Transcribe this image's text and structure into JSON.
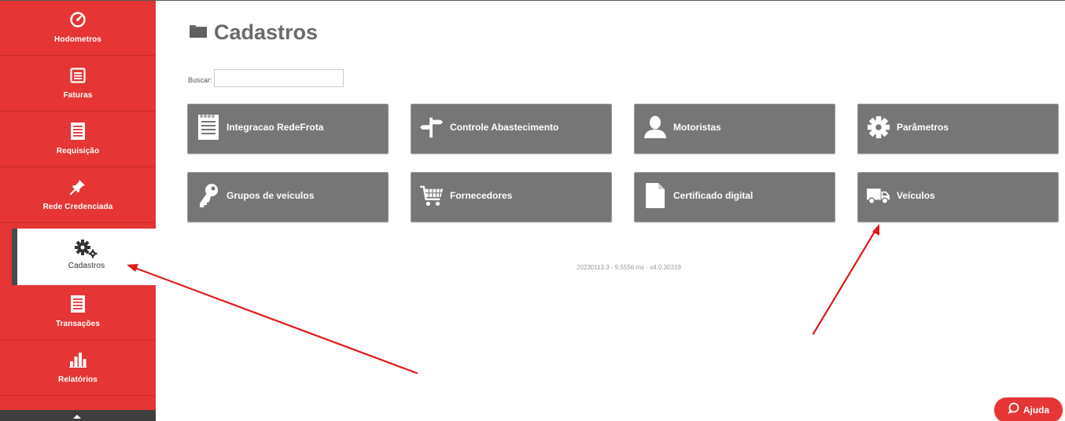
{
  "sidebar": {
    "items": [
      {
        "label": "Hodometros",
        "icon": "speedometer-icon"
      },
      {
        "label": "Faturas",
        "icon": "invoice-icon"
      },
      {
        "label": "Requisição",
        "icon": "document-list-icon"
      },
      {
        "label": "Rede Credenciada",
        "icon": "pushpin-icon"
      },
      {
        "label": "Cadastros",
        "icon": "gears-icon",
        "active": true
      },
      {
        "label": "Transações",
        "icon": "document-list-icon"
      },
      {
        "label": "Relatórios",
        "icon": "bar-chart-icon"
      }
    ]
  },
  "page": {
    "title": "Cadastros",
    "title_icon": "folder-icon"
  },
  "search": {
    "label": "Buscar:",
    "value": "",
    "placeholder": ""
  },
  "tiles": [
    {
      "label": "Integracao RedeFrota",
      "icon": "document-lines-icon"
    },
    {
      "label": "Controle Abastecimento",
      "icon": "signpost-icon"
    },
    {
      "label": "Motoristas",
      "icon": "user-icon"
    },
    {
      "label": "Parâmetros",
      "icon": "gear-icon"
    },
    {
      "label": "Grupos de veiculos",
      "icon": "key-icon"
    },
    {
      "label": "Fornecedores",
      "icon": "cart-icon"
    },
    {
      "label": "Certificado digital",
      "icon": "file-icon"
    },
    {
      "label": "Veículos",
      "icon": "truck-icon"
    }
  ],
  "footer": {
    "version": "20230113.3 - 9,5556 ms - v4.0.30319"
  },
  "help_button": {
    "label": "Ajuda",
    "icon": "chat-bubble-icon"
  },
  "colors": {
    "sidebar": "#e53535",
    "tile": "#767676",
    "annotation_arrow": "#e01b1b",
    "title": "#6b6b6b"
  }
}
